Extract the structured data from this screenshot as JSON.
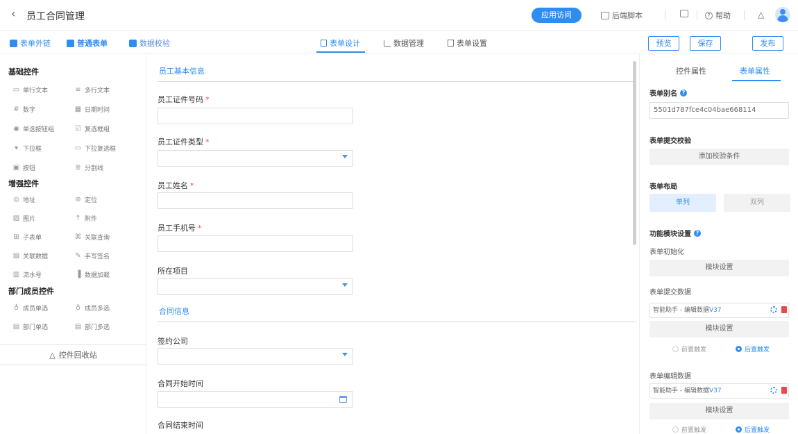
{
  "header": {
    "back_icon": "chevron-left-icon",
    "title": "员工合同管理",
    "access_button": "应用访问",
    "script_label": "后端脚本",
    "help_label": "帮助"
  },
  "toolbar": {
    "links": [
      {
        "label": "表单外链",
        "color": "#2f8cf0"
      },
      {
        "label": "普通表单",
        "color": "#2f8cf0"
      },
      {
        "label": "数据校验",
        "color": "#2f8cf0"
      }
    ],
    "tabs": [
      "表单设计",
      "数据管理",
      "表单设置"
    ],
    "active_tab": "表单设计",
    "buttons": {
      "preview": "预览",
      "save": "保存",
      "publish": "发布"
    }
  },
  "palette": {
    "basic": {
      "title": "基础控件",
      "items": [
        [
          "单行文本",
          "多行文本"
        ],
        [
          "数字",
          "日期时间"
        ],
        [
          "单选按钮组",
          "复选框组"
        ],
        [
          "下拉框",
          "下拉复选框"
        ],
        [
          "按钮",
          "分割线"
        ]
      ]
    },
    "enhanced": {
      "title": "增强控件",
      "items": [
        [
          "地址",
          "定位"
        ],
        [
          "图片",
          "附件"
        ],
        [
          "子表单",
          "关联查询"
        ],
        [
          "关联数据",
          "手写签名"
        ],
        [
          "流水号",
          "数据加载"
        ]
      ]
    },
    "dept": {
      "title": "部门成员控件",
      "items": [
        [
          "成员单选",
          "成员多选"
        ],
        [
          "部门单选",
          "部门多选"
        ]
      ]
    },
    "recycle": "控件回收站"
  },
  "form": {
    "section1": "员工基本信息",
    "fields1": [
      {
        "label": "员工证件号码",
        "required": "*"
      },
      {
        "label": "员工证件类型",
        "required": "*"
      },
      {
        "label": "员工姓名",
        "required": "*"
      },
      {
        "label": "员工手机号",
        "required": "*"
      },
      {
        "label": "所在项目",
        "required": ""
      }
    ],
    "section2": "合同信息",
    "fields2": [
      {
        "label": "签约公司"
      },
      {
        "label": "合同开始时间"
      },
      {
        "label": "合同结束时间"
      }
    ]
  },
  "props": {
    "tabs": [
      "控件属性",
      "表单属性"
    ],
    "active_tab": "表单属性",
    "alias_label": "表单别名",
    "alias_value": "5501d787fce4c04bae668114",
    "submit_check_label": "表单提交校验",
    "add_check_button": "添加校验条件",
    "layout_label": "表单布局",
    "layout_single": "单列",
    "layout_double": "双列",
    "module_label": "功能模块设置",
    "init_label": "表单初始化",
    "module_button": "模块设置",
    "submit_data_label": "表单提交数据",
    "assistant": "智能助手 - 编辑数据",
    "version": "V37",
    "pre_trigger": "前置触发",
    "post_trigger": "后置触发",
    "edit_data_label": "表单编辑数据"
  }
}
